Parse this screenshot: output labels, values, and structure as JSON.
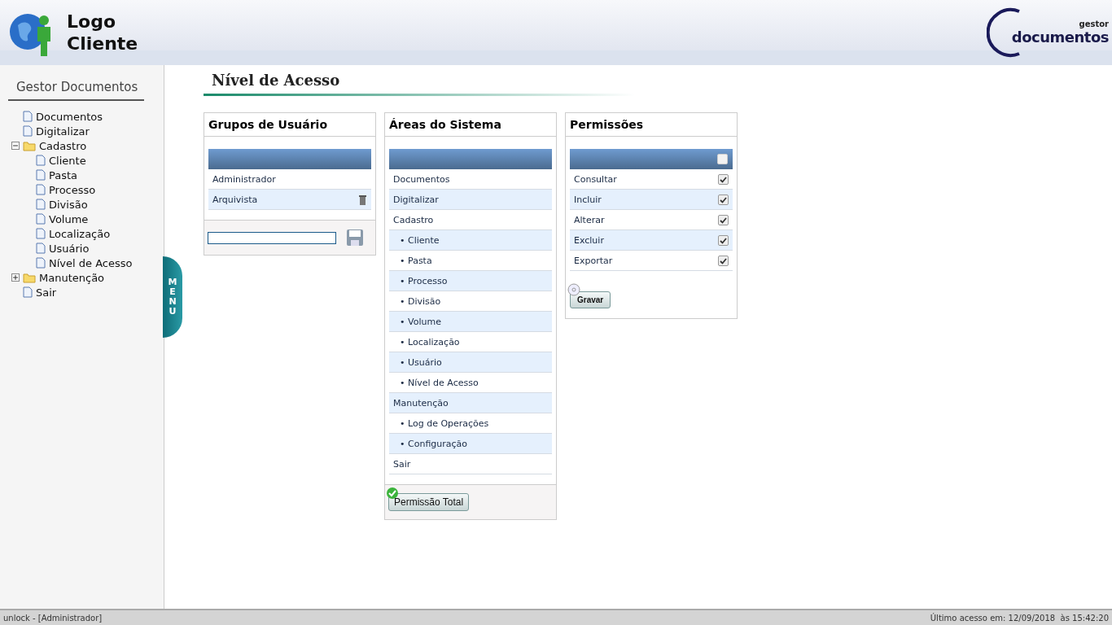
{
  "header": {
    "logo_lines": [
      "Logo",
      "Cliente"
    ],
    "brand_small": "gestor",
    "brand_large": "documentos"
  },
  "sidebar": {
    "title": "Gestor Documentos",
    "menu_tab": "MENU",
    "items": [
      {
        "label": "Documentos",
        "kind": "page"
      },
      {
        "label": "Digitalizar",
        "kind": "page"
      },
      {
        "label": "Cadastro",
        "kind": "folder",
        "expanded": true,
        "children": [
          {
            "label": "Cliente",
            "kind": "page"
          },
          {
            "label": "Pasta",
            "kind": "page"
          },
          {
            "label": "Processo",
            "kind": "page"
          },
          {
            "label": "Divisão",
            "kind": "page"
          },
          {
            "label": "Volume",
            "kind": "page"
          },
          {
            "label": "Localização",
            "kind": "page"
          },
          {
            "label": "Usuário",
            "kind": "page"
          },
          {
            "label": "Nível de Acesso",
            "kind": "page"
          }
        ]
      },
      {
        "label": "Manutenção",
        "kind": "folder",
        "expanded": false
      },
      {
        "label": "Sair",
        "kind": "page"
      }
    ]
  },
  "page_title": "Nível de Acesso",
  "groups": {
    "title": "Grupos de Usuário",
    "rows": [
      {
        "label": "Administrador",
        "deletable": false
      },
      {
        "label": "Arquivista",
        "deletable": true
      }
    ]
  },
  "areas": {
    "title": "Áreas do Sistema",
    "bullet": "•",
    "items": [
      {
        "label": "Documentos"
      },
      {
        "label": "Digitalizar"
      },
      {
        "label": "Cadastro",
        "children": [
          {
            "label": "Cliente"
          },
          {
            "label": "Pasta"
          },
          {
            "label": "Processo"
          },
          {
            "label": "Divisão"
          },
          {
            "label": "Volume"
          },
          {
            "label": "Localização"
          },
          {
            "label": "Usuário"
          },
          {
            "label": "Nível de Acesso"
          }
        ]
      },
      {
        "label": "Manutenção",
        "children": [
          {
            "label": "Log de Operações"
          },
          {
            "label": "Configuração"
          }
        ]
      },
      {
        "label": "Sair"
      }
    ],
    "button": "Permissão Total"
  },
  "permissions": {
    "title": "Permissões",
    "all_checked": false,
    "rows": [
      {
        "label": "Consultar",
        "checked": true
      },
      {
        "label": "Incluir",
        "checked": true
      },
      {
        "label": "Alterar",
        "checked": true
      },
      {
        "label": "Excluir",
        "checked": true
      },
      {
        "label": "Exportar",
        "checked": true
      }
    ],
    "button": "Gravar"
  },
  "status_bar": {
    "left": "unlock - [Administrador]",
    "right": "Último acesso em: 12/09/2018  às 15:42:20"
  }
}
